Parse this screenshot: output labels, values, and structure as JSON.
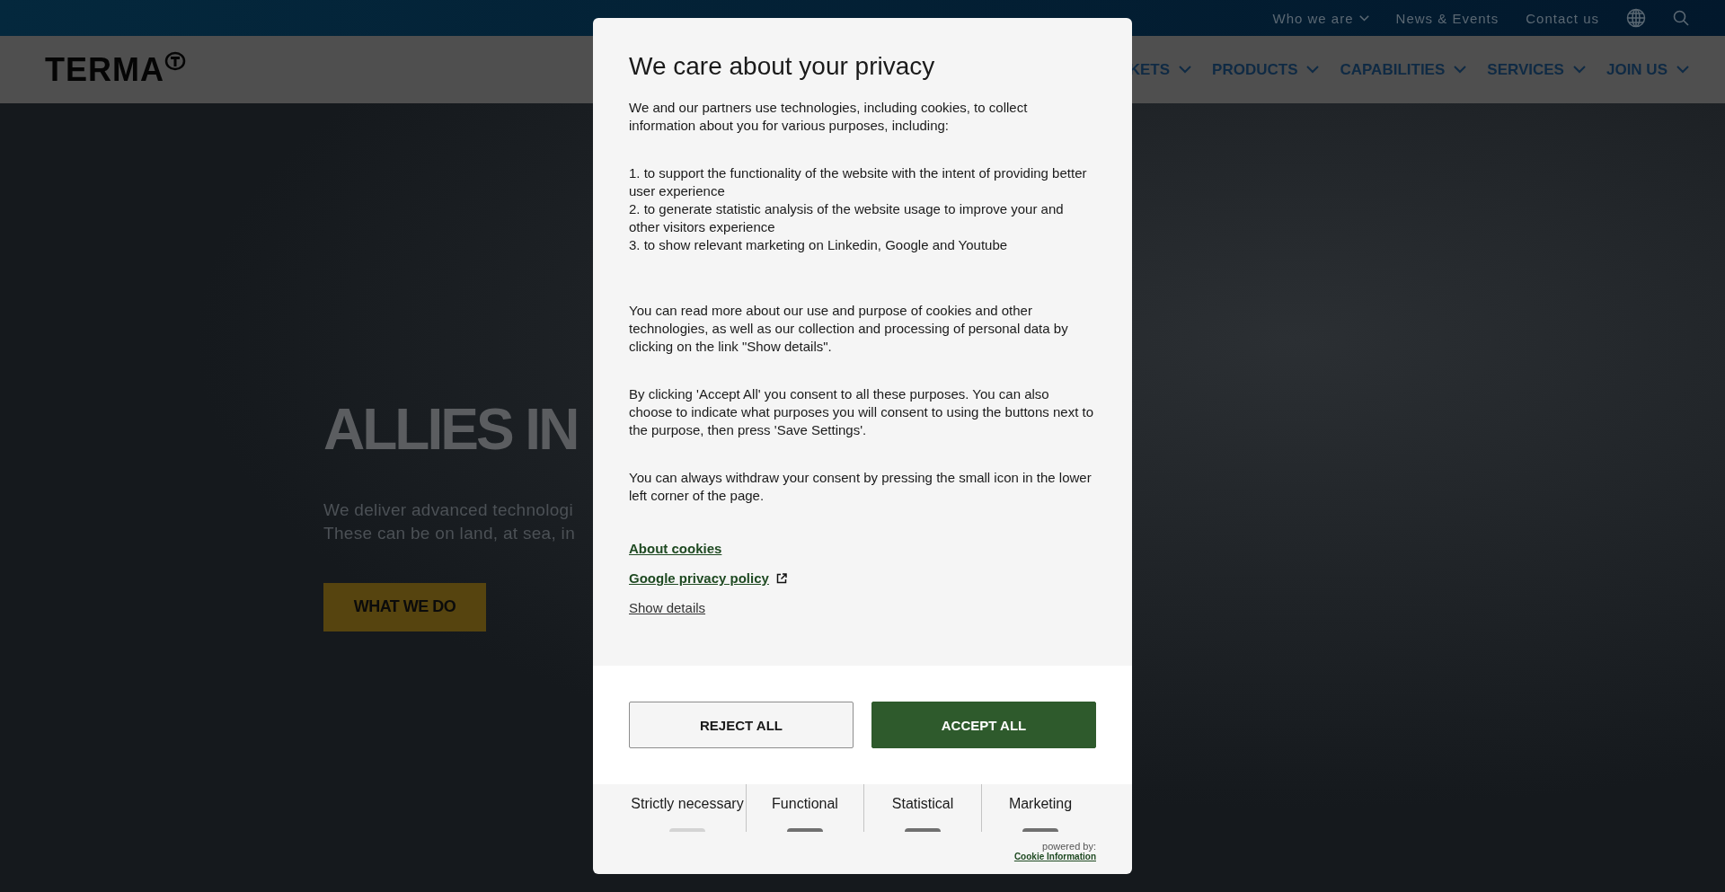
{
  "top_links": [
    {
      "label": "Who we are",
      "kind": "dropdown"
    },
    {
      "label": "News & Events",
      "kind": "link"
    },
    {
      "label": "Contact us",
      "kind": "link"
    }
  ],
  "logo": {
    "text": "TERMA"
  },
  "nav": {
    "items": [
      {
        "label": "KETS"
      },
      {
        "label": "PRODUCTS"
      },
      {
        "label": "CAPABILITIES"
      },
      {
        "label": "SERVICES"
      },
      {
        "label": "JOIN US"
      }
    ]
  },
  "hero": {
    "title": "ALLIES IN",
    "lines": [
      "We deliver advanced technologi",
      "These can be on land, at sea, in"
    ],
    "button": "WHAT WE DO"
  },
  "dialog": {
    "title": "We care about your privacy",
    "intro": "We and our partners use technologies, including cookies, to collect information about you for various purposes, including:",
    "purposes": [
      "1. to support the functionality of the website with the intent of providing better user experience",
      "2. to generate statistic analysis of the website usage to improve your and other visitors experience",
      "3. to show relevant marketing on Linkedin, Google and Youtube"
    ],
    "paragraphs": [
      "You can read more about our use and purpose of cookies and other technologies, as well as our collection and processing of personal data by clicking on the link \"Show details\".",
      "By clicking 'Accept All' you consent to all these purposes. You can also choose to indicate what purposes you will consent to using the buttons next to the purpose, then press 'Save Settings'.",
      "You can always withdraw your consent by pressing the small icon in the lower left corner of the page."
    ],
    "links": [
      {
        "label": "About cookies",
        "kind": "internal"
      },
      {
        "label": "Google privacy policy",
        "kind": "external"
      },
      {
        "label": "Show details",
        "kind": "plain"
      }
    ],
    "buttons": [
      {
        "label": "REJECT ALL",
        "kind": "secondary"
      },
      {
        "label": "ACCEPT ALL",
        "kind": "primary"
      }
    ],
    "categories": [
      {
        "label": "Strictly necessary",
        "disabled": true
      },
      {
        "label": "Functional",
        "disabled": false
      },
      {
        "label": "Statistical",
        "disabled": false
      },
      {
        "label": "Marketing",
        "disabled": false
      }
    ],
    "powered_by": "powered by:",
    "provider_link": "Cookie Information"
  }
}
